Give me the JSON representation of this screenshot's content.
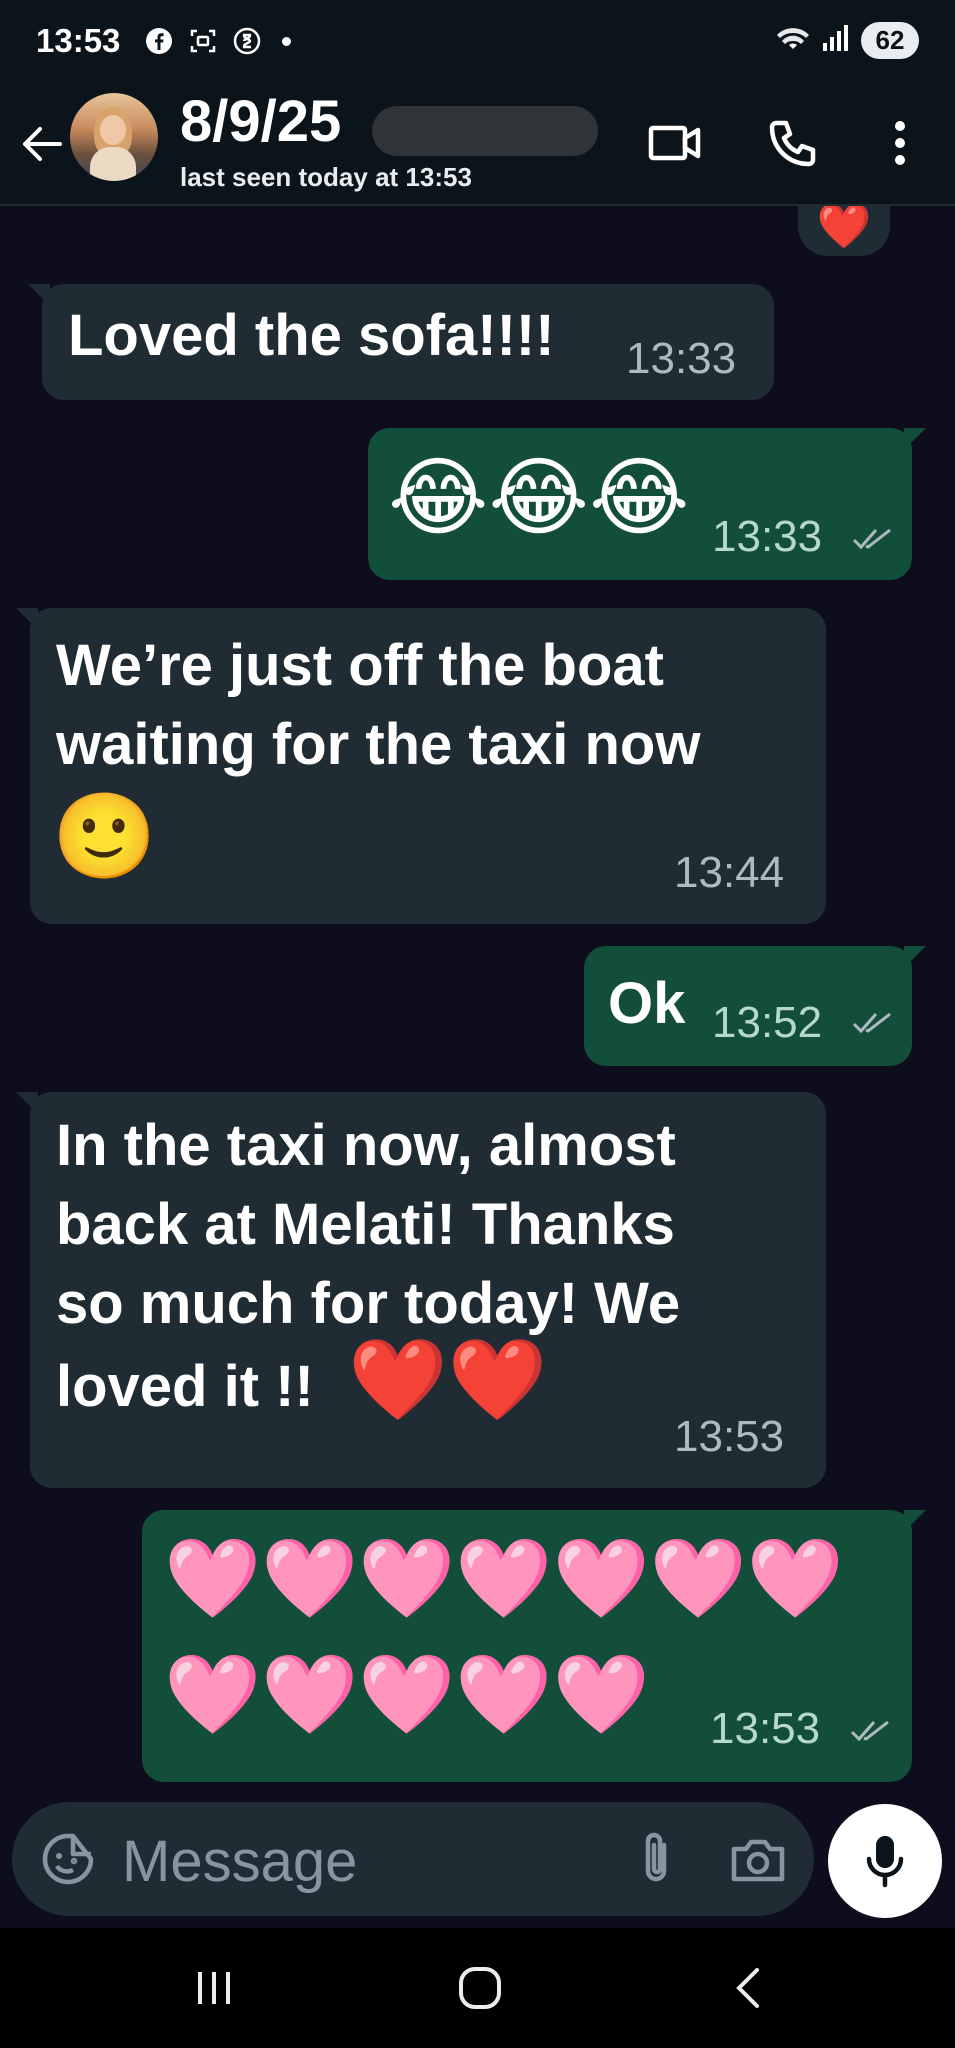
{
  "status_bar": {
    "time": "13:53",
    "battery": "62"
  },
  "header": {
    "contact_name": "8/9/25",
    "last_seen": "last seen today at 13:53"
  },
  "messages": [
    {
      "direction": "in",
      "text": "Loved the sofa!!!!",
      "time": "13:33"
    },
    {
      "direction": "out",
      "emoji": "😂😂😂",
      "time": "13:33",
      "read": true
    },
    {
      "direction": "in",
      "text_lines": [
        "We’re just off the boat",
        "waiting for the taxi now"
      ],
      "emoji": "🙂",
      "time": "13:44"
    },
    {
      "direction": "out",
      "text": "Ok",
      "time": "13:52",
      "read": true
    },
    {
      "direction": "in",
      "text_lines": [
        "In the taxi now, almost",
        "back at Melati! Thanks",
        "so much for today! We",
        "loved it !!"
      ],
      "emoji": "❤️❤️",
      "time": "13:53"
    },
    {
      "direction": "out",
      "emoji_lines": [
        "🩷🩷🩷🩷🩷🩷🩷",
        "🩷🩷🩷🩷🩷"
      ],
      "time": "13:53",
      "read": true
    }
  ],
  "reaction": "❤️",
  "input": {
    "placeholder": "Message"
  },
  "colors": {
    "chat_background": "#0e0d1e",
    "incoming_bubble": "#202c33",
    "outgoing_bubble": "#134e3a",
    "timestamp": "#aebac1",
    "read_ticks": "#aebac1"
  },
  "icons": [
    "facebook-icon",
    "screenshot-icon",
    "hourglass-icon",
    "wifi-icon",
    "signal-icon",
    "back-arrow-icon",
    "video-call-icon",
    "phone-icon",
    "more-options-icon",
    "sticker-icon",
    "attach-icon",
    "camera-icon",
    "mic-icon",
    "recent-apps-icon",
    "home-icon",
    "nav-back-icon"
  ]
}
